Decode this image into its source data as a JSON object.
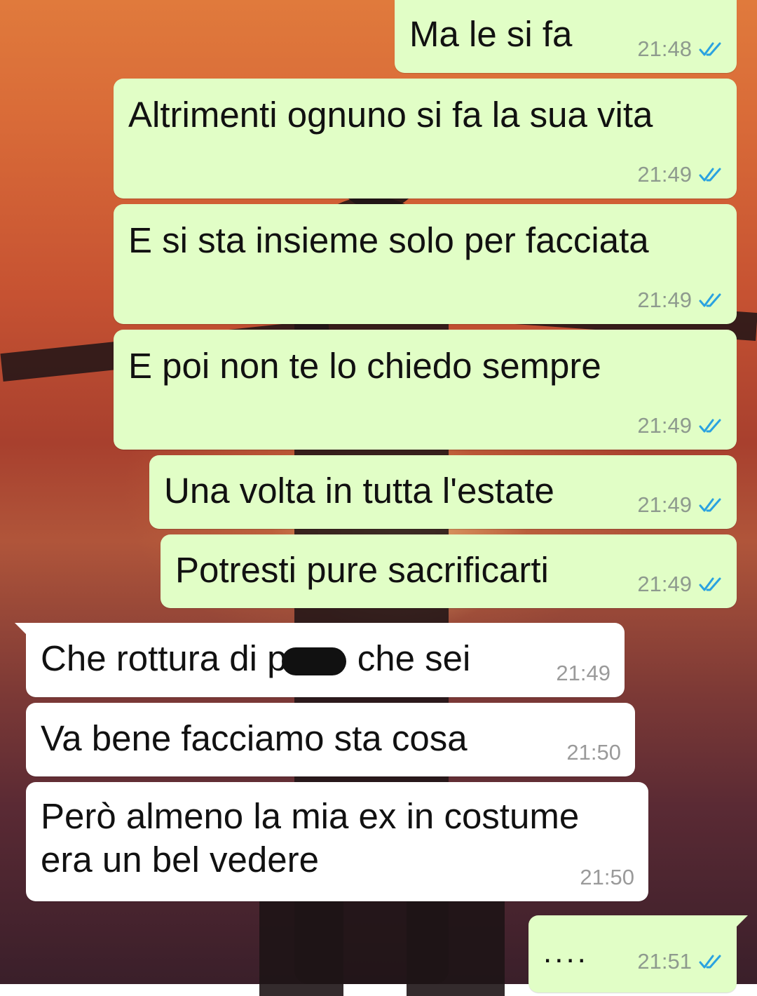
{
  "colors": {
    "outgoing_bubble": "#e1fec6",
    "incoming_bubble": "#ffffff",
    "read_ticks": "#2aa2e0",
    "timestamp": "#8e9a8e"
  },
  "messages": [
    {
      "text": "Ma le si fa",
      "time": "21:48",
      "direction": "out",
      "ticks": "double-check-read-icon"
    },
    {
      "text": "Altrimenti ognuno si fa la sua vita",
      "time": "21:49",
      "direction": "out",
      "ticks": "double-check-read-icon"
    },
    {
      "text": "E si sta insieme solo per facciata",
      "time": "21:49",
      "direction": "out",
      "ticks": "double-check-read-icon"
    },
    {
      "text": "E poi non te lo chiedo sempre",
      "time": "21:49",
      "direction": "out",
      "ticks": "double-check-read-icon"
    },
    {
      "text": "Una volta in tutta l'estate",
      "time": "21:49",
      "direction": "out",
      "ticks": "double-check-read-icon"
    },
    {
      "text": "Potresti pure sacrificarti",
      "time": "21:49",
      "direction": "out",
      "ticks": "double-check-read-icon"
    },
    {
      "text_before": "Che rottura di p",
      "text_after": "che sei",
      "time": "21:49",
      "direction": "in",
      "redacted": true
    },
    {
      "text": "Va bene facciamo sta cosa",
      "time": "21:50",
      "direction": "in"
    },
    {
      "text_line1": "Però almeno la mia ex in costume",
      "text_line2": "era un bel vedere",
      "time": "21:50",
      "direction": "in"
    },
    {
      "text": "....",
      "time": "21:51",
      "direction": "out",
      "ticks": "double-check-read-icon"
    }
  ]
}
